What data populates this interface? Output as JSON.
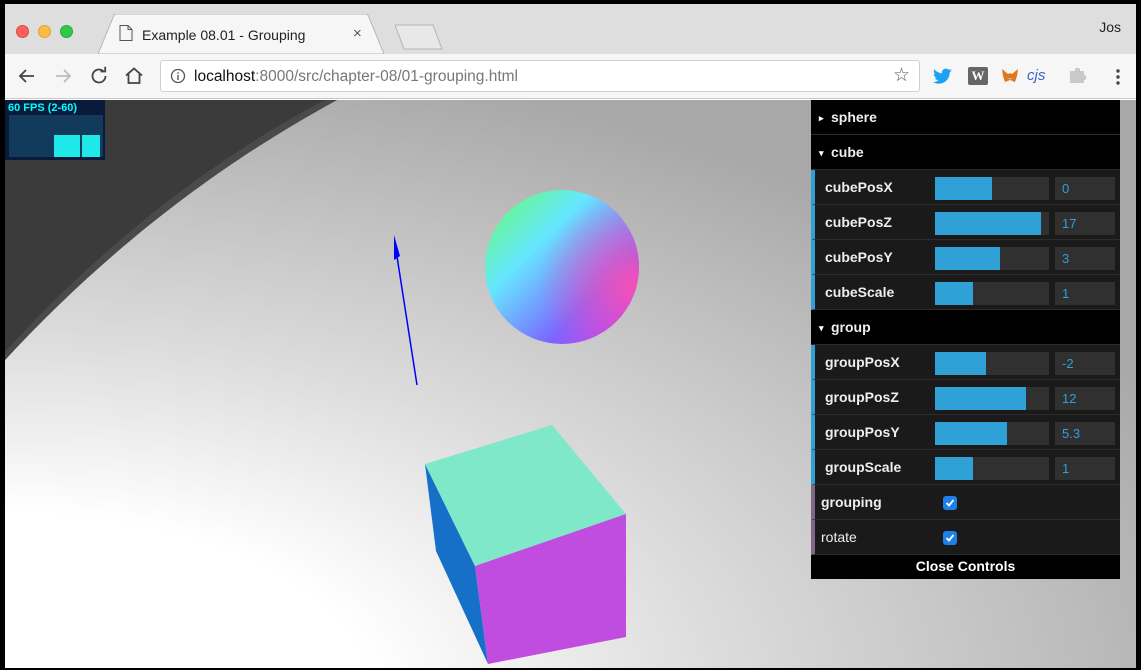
{
  "browser": {
    "tab": {
      "title": "Example 08.01 - Grouping",
      "close_glyph": "×"
    },
    "profile_name": "Jos",
    "url": {
      "host": "localhost",
      "rest": ":8000/src/chapter-08/01-grouping.html"
    },
    "icons": {
      "back": "arrow-left-icon",
      "forward": "arrow-right-icon",
      "reload": "reload-icon",
      "home": "home-icon",
      "info": "info-icon",
      "star": "star-icon",
      "menu": "kebab-menu-icon"
    },
    "extensions": [
      "twitter-icon",
      "wikipedia-icon",
      "metamask-icon",
      "cjs-icon",
      "extension-icon"
    ],
    "extension_text": {
      "wikipedia": "W",
      "cjs": "cjs"
    }
  },
  "stats": {
    "label": "60 FPS (2-60)"
  },
  "gui": {
    "folders": [
      {
        "name": "sphere",
        "open": false,
        "controllers": []
      },
      {
        "name": "cube",
        "open": true,
        "controllers": [
          {
            "label": "cubePosX",
            "value": "0",
            "fraction": 0.5
          },
          {
            "label": "cubePosZ",
            "value": "17",
            "fraction": 0.93
          },
          {
            "label": "cubePosY",
            "value": "3",
            "fraction": 0.57
          },
          {
            "label": "cubeScale",
            "value": "1",
            "fraction": 0.33
          }
        ]
      },
      {
        "name": "group",
        "open": true,
        "controllers": [
          {
            "label": "groupPosX",
            "value": "-2",
            "fraction": 0.45
          },
          {
            "label": "groupPosZ",
            "value": "12",
            "fraction": 0.8
          },
          {
            "label": "groupPosY",
            "value": "5.3",
            "fraction": 0.63
          },
          {
            "label": "groupScale",
            "value": "1",
            "fraction": 0.33
          }
        ]
      }
    ],
    "checkboxes": [
      {
        "label": "grouping",
        "checked": true
      },
      {
        "label": "rotate",
        "checked": true
      }
    ],
    "close_label": "Close Controls"
  },
  "colors": {
    "accent": "#2fa1d6",
    "cube_top": "#7fe8c8",
    "cube_front": "#c04ce0",
    "cube_side": "#1670c8",
    "arrow": "#0000ff"
  }
}
